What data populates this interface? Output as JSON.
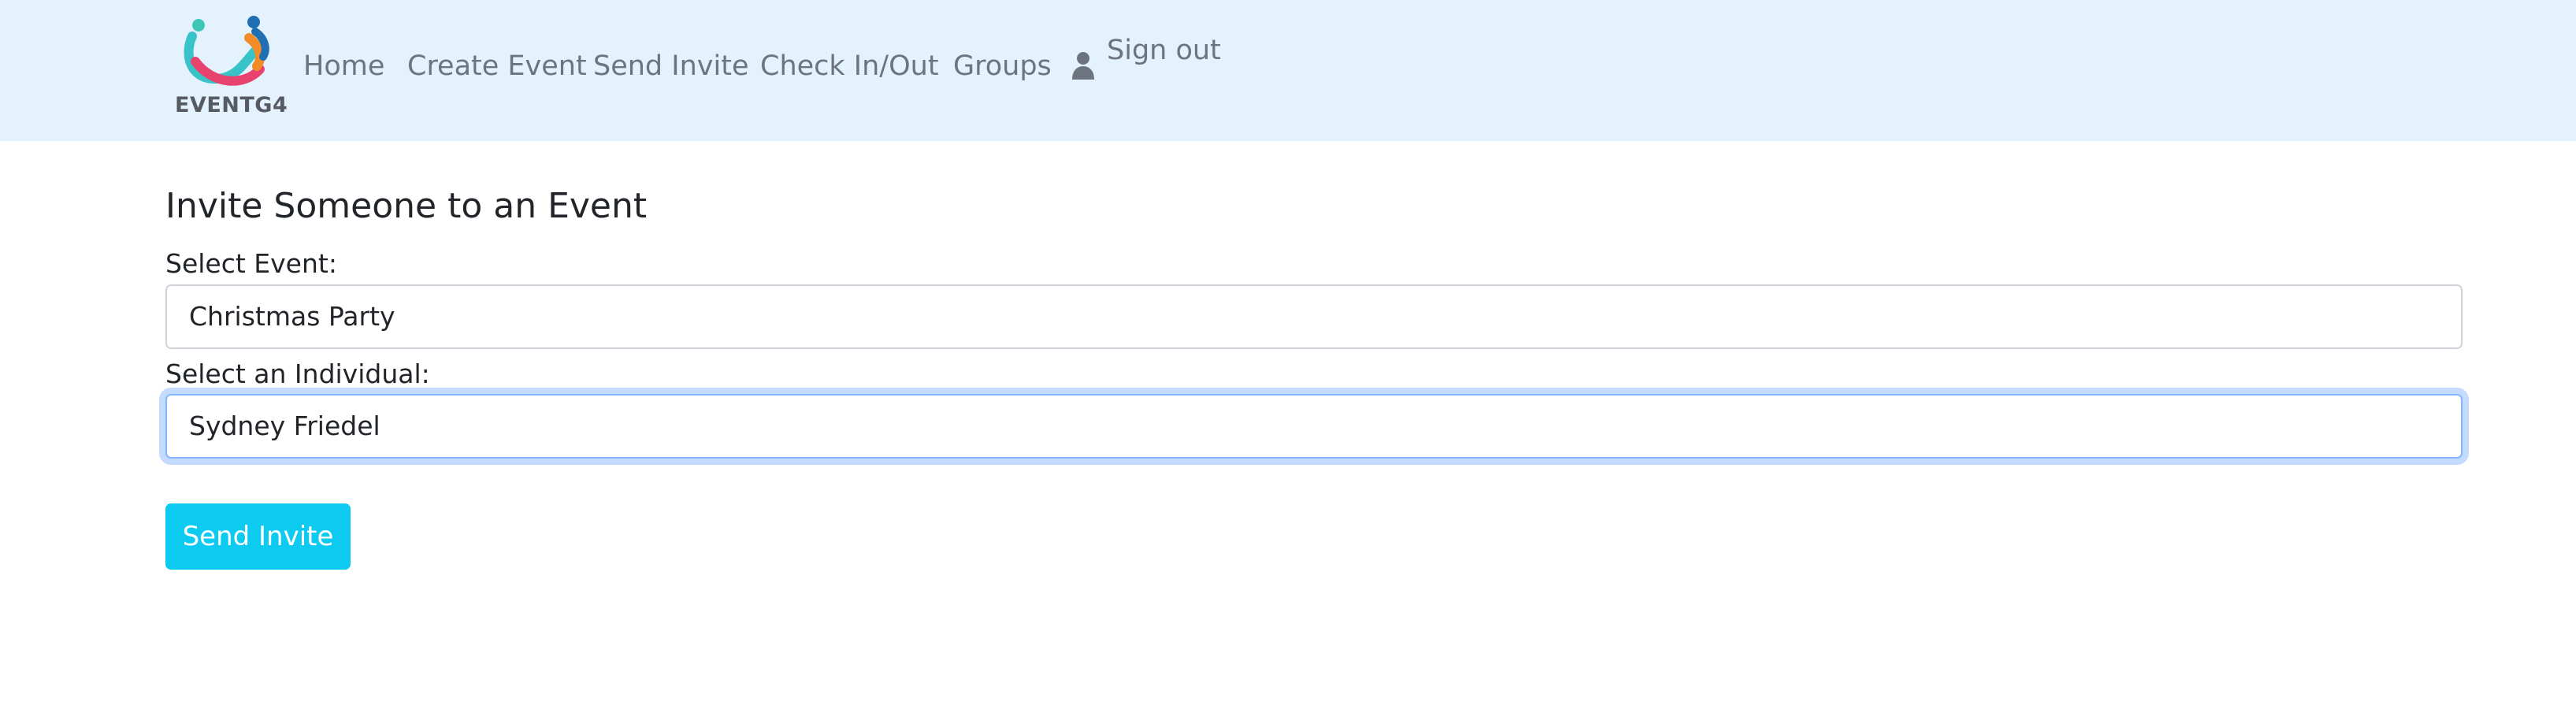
{
  "brand": {
    "name": "EVENTG4",
    "logo_icon": "people-embrace-logo-icon"
  },
  "nav": {
    "items": [
      {
        "label": "Home"
      },
      {
        "label": "Create Event"
      },
      {
        "label": "Send Invite"
      },
      {
        "label": "Check In/Out"
      },
      {
        "label": "Groups"
      }
    ],
    "user_icon": "user-icon",
    "sign_out_label": "Sign out"
  },
  "form": {
    "title": "Invite Someone to an Event",
    "event_label": "Select Event:",
    "event_value": "Christmas Party",
    "individual_label": "Select an Individual:",
    "individual_value": "Sydney Friedel",
    "submit_label": "Send Invite"
  },
  "colors": {
    "navbar_bg": "#e3f2fd",
    "button_bg": "#0dcaf0",
    "focus_ring": "#86b7fe",
    "nav_text": "#6c757d"
  }
}
